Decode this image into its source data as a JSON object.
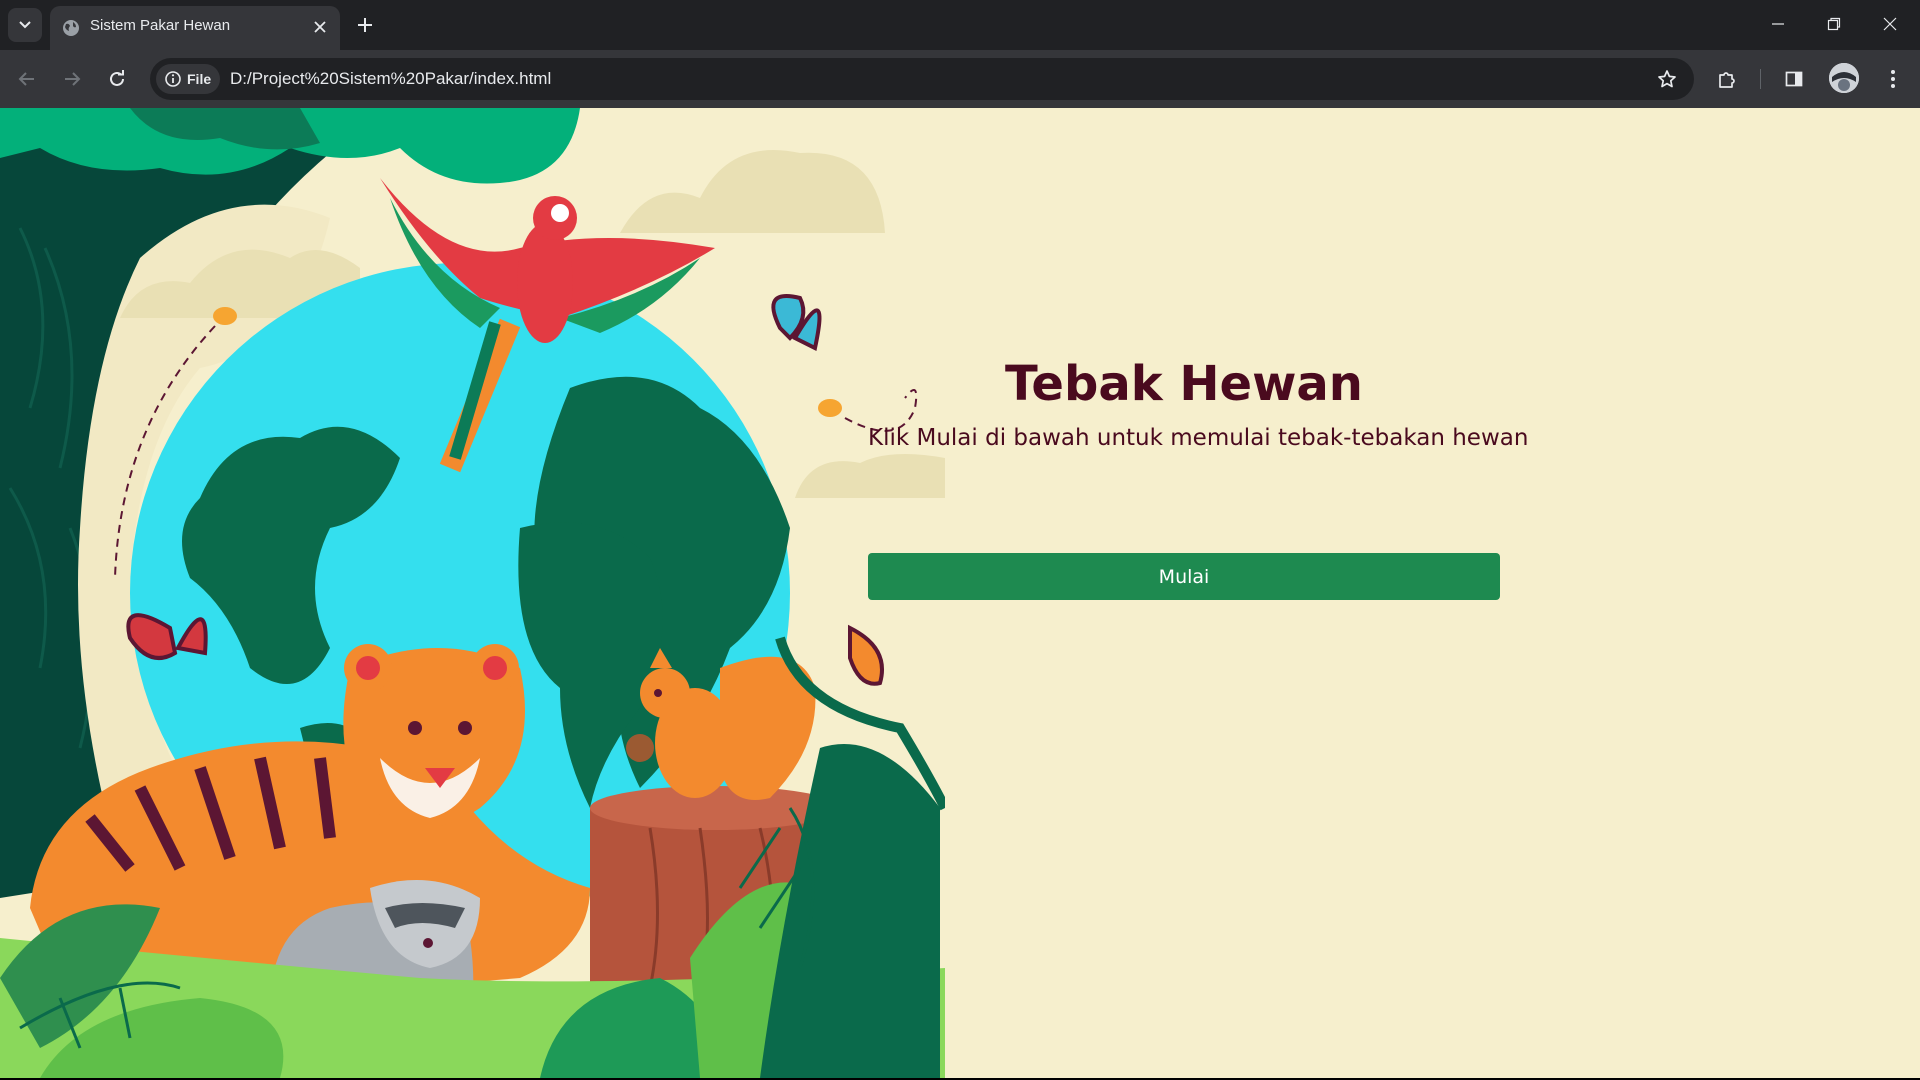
{
  "browser": {
    "tab_title": "Sistem Pakar Hewan",
    "site_chip_label": "File",
    "url": "D:/Project%20Sistem%20Pakar/index.html"
  },
  "icons": [
    "tab-list-icon",
    "globe-icon",
    "close-icon",
    "plus-icon",
    "minimize-icon",
    "restore-icon",
    "window-close-icon",
    "back-arrow-icon",
    "forward-arrow-icon",
    "reload-icon",
    "info-icon",
    "star-icon",
    "extensions-icon",
    "side-panel-icon",
    "profile-avatar-icon",
    "more-menu-icon"
  ],
  "colors": {
    "page_background": "#f6efcd",
    "heading_color": "#4a0a1e",
    "button_color": "#1e8a50",
    "button_text_color": "#ffffff"
  },
  "page": {
    "title": "Tebak Hewan",
    "subtitle": "Klik Mulai di bawah untuk memulai tebak-tebakan hewan",
    "start_button_label": "Mulai"
  }
}
